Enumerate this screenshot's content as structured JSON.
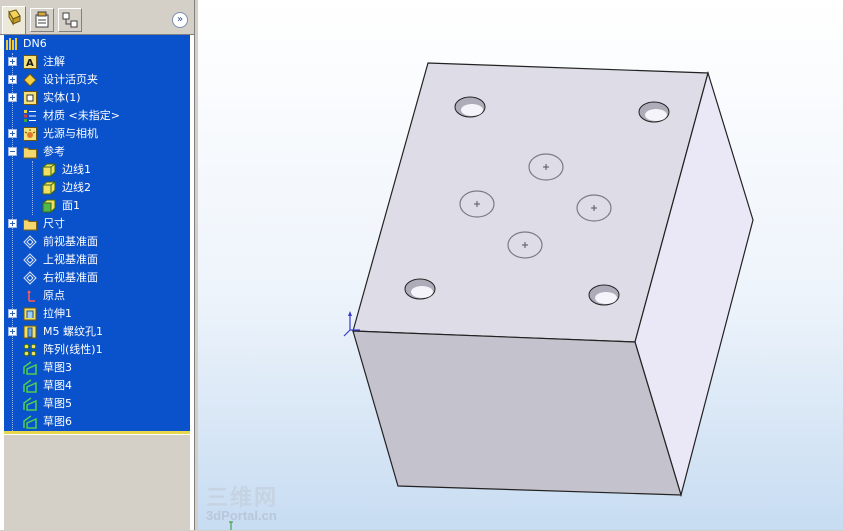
{
  "panel": {
    "tabs": [
      "feature-manager",
      "property-manager",
      "configuration-manager"
    ],
    "collapse_symbol": "»",
    "root_label": "DN6",
    "items": [
      {
        "label": "注解",
        "icon": "annotation-icon",
        "expander": "plus"
      },
      {
        "label": "设计活页夹",
        "icon": "design-binder-icon",
        "expander": "plus"
      },
      {
        "label": "实体(1)",
        "icon": "solid-bodies-icon",
        "expander": "plus"
      },
      {
        "label": "材质 <未指定>",
        "icon": "material-icon",
        "expander": "none"
      },
      {
        "label": "光源与相机",
        "icon": "lights-camera-icon",
        "expander": "plus"
      },
      {
        "label": "参考",
        "icon": "folder-icon",
        "expander": "minus"
      },
      {
        "label": "边线1",
        "icon": "reference-edge-icon",
        "expander": "none"
      },
      {
        "label": "边线2",
        "icon": "reference-edge-icon",
        "expander": "none"
      },
      {
        "label": "面1",
        "icon": "reference-face-icon",
        "expander": "none"
      },
      {
        "label": "尺寸",
        "icon": "folder-icon",
        "expander": "plus"
      },
      {
        "label": "前视基准面",
        "icon": "plane-icon",
        "expander": "none"
      },
      {
        "label": "上视基准面",
        "icon": "plane-icon",
        "expander": "none"
      },
      {
        "label": "右视基准面",
        "icon": "plane-icon",
        "expander": "none"
      },
      {
        "label": "原点",
        "icon": "origin-icon",
        "expander": "none"
      },
      {
        "label": "拉伸1",
        "icon": "extrude-icon",
        "expander": "plus"
      },
      {
        "label": "M5 螺纹孔1",
        "icon": "hole-wizard-icon",
        "expander": "plus"
      },
      {
        "label": "阵列(线性)1",
        "icon": "linear-pattern-icon",
        "expander": "none"
      },
      {
        "label": "草图3",
        "icon": "sketch-icon",
        "expander": "none"
      },
      {
        "label": "草图4",
        "icon": "sketch-icon",
        "expander": "none"
      },
      {
        "label": "草图5",
        "icon": "sketch-icon",
        "expander": "none"
      },
      {
        "label": "草图6",
        "icon": "sketch-icon",
        "expander": "none"
      }
    ]
  },
  "watermark": {
    "logo_text": "三维网",
    "site_text": "3dPortal.cn"
  },
  "colors": {
    "tree_background": "#0a52cc",
    "tree_text": "#ffffff",
    "cube_top": "#dedce6",
    "cube_front": "#c4c2cc",
    "cube_right": "#eae8f6"
  }
}
